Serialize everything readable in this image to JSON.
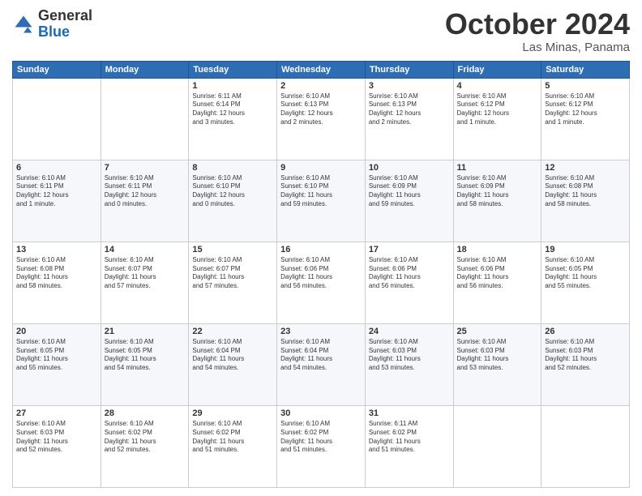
{
  "header": {
    "logo": {
      "general": "General",
      "blue": "Blue"
    },
    "title": "October 2024",
    "location": "Las Minas, Panama"
  },
  "weekdays": [
    "Sunday",
    "Monday",
    "Tuesday",
    "Wednesday",
    "Thursday",
    "Friday",
    "Saturday"
  ],
  "weeks": [
    [
      {
        "day": "",
        "info": ""
      },
      {
        "day": "",
        "info": ""
      },
      {
        "day": "1",
        "info": "Sunrise: 6:11 AM\nSunset: 6:14 PM\nDaylight: 12 hours\nand 3 minutes."
      },
      {
        "day": "2",
        "info": "Sunrise: 6:10 AM\nSunset: 6:13 PM\nDaylight: 12 hours\nand 2 minutes."
      },
      {
        "day": "3",
        "info": "Sunrise: 6:10 AM\nSunset: 6:13 PM\nDaylight: 12 hours\nand 2 minutes."
      },
      {
        "day": "4",
        "info": "Sunrise: 6:10 AM\nSunset: 6:12 PM\nDaylight: 12 hours\nand 1 minute."
      },
      {
        "day": "5",
        "info": "Sunrise: 6:10 AM\nSunset: 6:12 PM\nDaylight: 12 hours\nand 1 minute."
      }
    ],
    [
      {
        "day": "6",
        "info": "Sunrise: 6:10 AM\nSunset: 6:11 PM\nDaylight: 12 hours\nand 1 minute."
      },
      {
        "day": "7",
        "info": "Sunrise: 6:10 AM\nSunset: 6:11 PM\nDaylight: 12 hours\nand 0 minutes."
      },
      {
        "day": "8",
        "info": "Sunrise: 6:10 AM\nSunset: 6:10 PM\nDaylight: 12 hours\nand 0 minutes."
      },
      {
        "day": "9",
        "info": "Sunrise: 6:10 AM\nSunset: 6:10 PM\nDaylight: 11 hours\nand 59 minutes."
      },
      {
        "day": "10",
        "info": "Sunrise: 6:10 AM\nSunset: 6:09 PM\nDaylight: 11 hours\nand 59 minutes."
      },
      {
        "day": "11",
        "info": "Sunrise: 6:10 AM\nSunset: 6:09 PM\nDaylight: 11 hours\nand 58 minutes."
      },
      {
        "day": "12",
        "info": "Sunrise: 6:10 AM\nSunset: 6:08 PM\nDaylight: 11 hours\nand 58 minutes."
      }
    ],
    [
      {
        "day": "13",
        "info": "Sunrise: 6:10 AM\nSunset: 6:08 PM\nDaylight: 11 hours\nand 58 minutes."
      },
      {
        "day": "14",
        "info": "Sunrise: 6:10 AM\nSunset: 6:07 PM\nDaylight: 11 hours\nand 57 minutes."
      },
      {
        "day": "15",
        "info": "Sunrise: 6:10 AM\nSunset: 6:07 PM\nDaylight: 11 hours\nand 57 minutes."
      },
      {
        "day": "16",
        "info": "Sunrise: 6:10 AM\nSunset: 6:06 PM\nDaylight: 11 hours\nand 56 minutes."
      },
      {
        "day": "17",
        "info": "Sunrise: 6:10 AM\nSunset: 6:06 PM\nDaylight: 11 hours\nand 56 minutes."
      },
      {
        "day": "18",
        "info": "Sunrise: 6:10 AM\nSunset: 6:06 PM\nDaylight: 11 hours\nand 56 minutes."
      },
      {
        "day": "19",
        "info": "Sunrise: 6:10 AM\nSunset: 6:05 PM\nDaylight: 11 hours\nand 55 minutes."
      }
    ],
    [
      {
        "day": "20",
        "info": "Sunrise: 6:10 AM\nSunset: 6:05 PM\nDaylight: 11 hours\nand 55 minutes."
      },
      {
        "day": "21",
        "info": "Sunrise: 6:10 AM\nSunset: 6:05 PM\nDaylight: 11 hours\nand 54 minutes."
      },
      {
        "day": "22",
        "info": "Sunrise: 6:10 AM\nSunset: 6:04 PM\nDaylight: 11 hours\nand 54 minutes."
      },
      {
        "day": "23",
        "info": "Sunrise: 6:10 AM\nSunset: 6:04 PM\nDaylight: 11 hours\nand 54 minutes."
      },
      {
        "day": "24",
        "info": "Sunrise: 6:10 AM\nSunset: 6:03 PM\nDaylight: 11 hours\nand 53 minutes."
      },
      {
        "day": "25",
        "info": "Sunrise: 6:10 AM\nSunset: 6:03 PM\nDaylight: 11 hours\nand 53 minutes."
      },
      {
        "day": "26",
        "info": "Sunrise: 6:10 AM\nSunset: 6:03 PM\nDaylight: 11 hours\nand 52 minutes."
      }
    ],
    [
      {
        "day": "27",
        "info": "Sunrise: 6:10 AM\nSunset: 6:03 PM\nDaylight: 11 hours\nand 52 minutes."
      },
      {
        "day": "28",
        "info": "Sunrise: 6:10 AM\nSunset: 6:02 PM\nDaylight: 11 hours\nand 52 minutes."
      },
      {
        "day": "29",
        "info": "Sunrise: 6:10 AM\nSunset: 6:02 PM\nDaylight: 11 hours\nand 51 minutes."
      },
      {
        "day": "30",
        "info": "Sunrise: 6:10 AM\nSunset: 6:02 PM\nDaylight: 11 hours\nand 51 minutes."
      },
      {
        "day": "31",
        "info": "Sunrise: 6:11 AM\nSunset: 6:02 PM\nDaylight: 11 hours\nand 51 minutes."
      },
      {
        "day": "",
        "info": ""
      },
      {
        "day": "",
        "info": ""
      }
    ]
  ]
}
